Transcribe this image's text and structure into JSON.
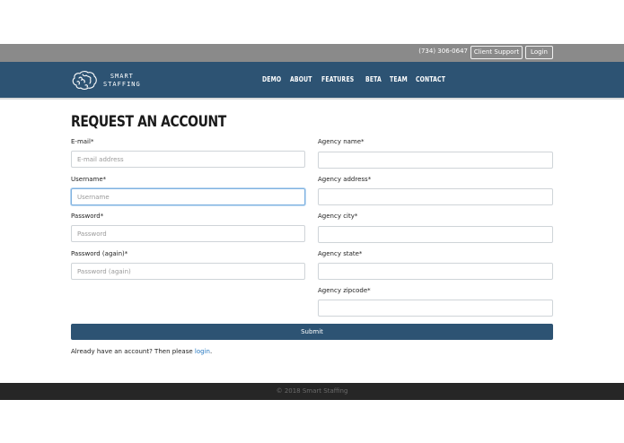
{
  "topbar": {
    "phone": "(734) 306-0647",
    "support_label": "Client Support",
    "login_label": "Login"
  },
  "brand": {
    "line1": "SMART",
    "line2": "STAFFING",
    "logo_icon": "brain-icon"
  },
  "nav": {
    "items": [
      "DEMO",
      "ABOUT",
      "FEATURES",
      "BETA",
      "TEAM",
      "CONTACT"
    ]
  },
  "form": {
    "title": "REQUEST AN ACCOUNT",
    "email_label": "E-mail*",
    "email_placeholder": "E-mail address",
    "username_label": "Username*",
    "username_placeholder": "Username",
    "password_label": "Password*",
    "password_placeholder": "Password",
    "password2_label": "Password (again)*",
    "password2_placeholder": "Password (again)",
    "agency_name_label": "Agency name*",
    "agency_address_label": "Agency address*",
    "agency_city_label": "Agency city*",
    "agency_state_label": "Agency state*",
    "agency_zip_label": "Agency zipcode*",
    "submit_label": "Submit",
    "already_text": "Already have an account? Then please ",
    "login_link": "login",
    "already_end": "."
  },
  "footer": {
    "copyright": "© 2018 Smart Staffing"
  },
  "colors": {
    "navbar": "#2d5373",
    "topbar": "#8a8a8a",
    "footer": "#262626",
    "link": "#2a7ac2"
  }
}
